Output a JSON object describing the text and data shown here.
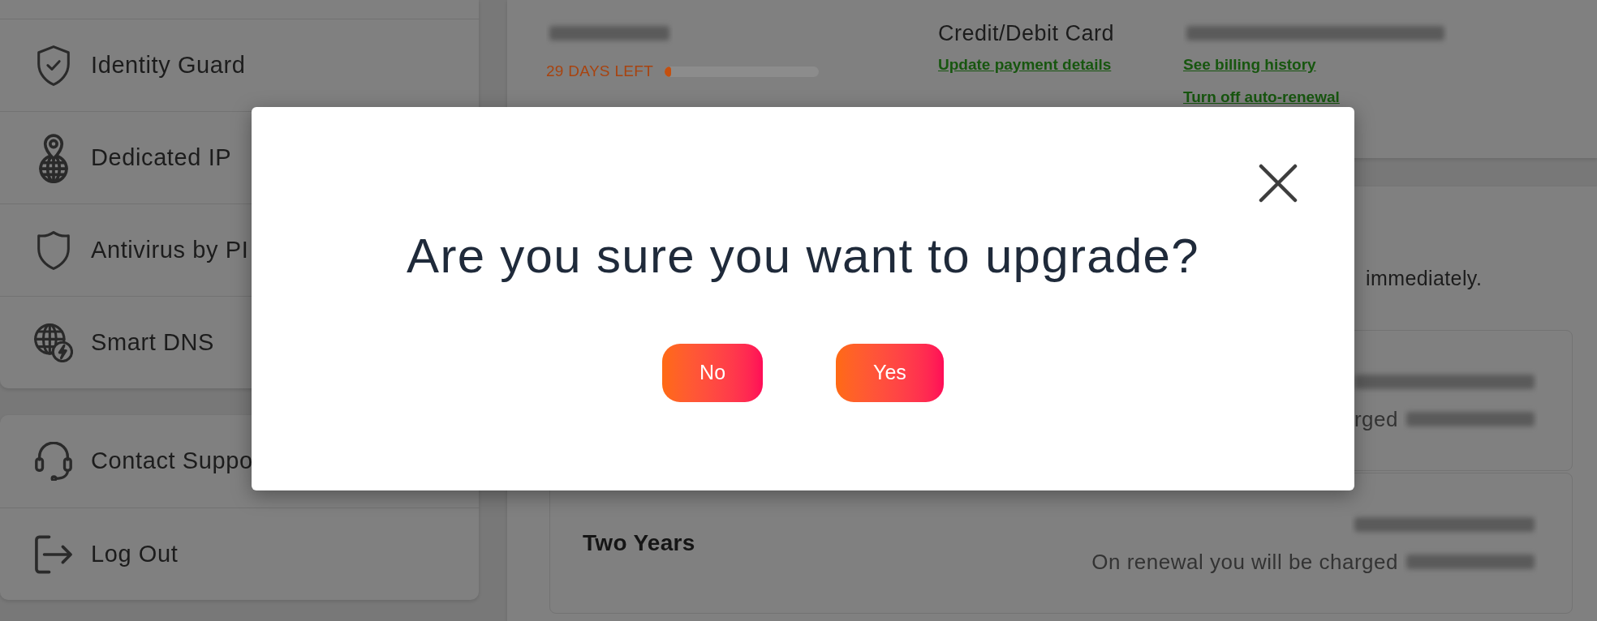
{
  "sidebar": {
    "groups": [
      {
        "items": [
          {
            "label": "Identity Guard",
            "selected": false
          },
          {
            "label": "Dedicated IP",
            "selected": false
          },
          {
            "label": "Antivirus by PI",
            "selected": false
          },
          {
            "label": "Smart DNS",
            "selected": false
          }
        ]
      },
      {
        "items": [
          {
            "label": "Contact Suppo",
            "selected": false
          },
          {
            "label": "Log Out",
            "selected": false
          }
        ]
      }
    ]
  },
  "subscription": {
    "days_left": "29 DAYS LEFT",
    "level": 0.04
  },
  "payment": {
    "method": "Credit/Debit Card",
    "link": "Update payment details"
  },
  "billing": {
    "links": [
      "See billing history",
      "Turn off auto-renewal"
    ]
  },
  "upgrade": {
    "description": "immediately.",
    "plans": [
      {
        "renewal_text": "rged"
      },
      {
        "name": "Two Years",
        "renewal_text": "On renewal you will be charged"
      }
    ]
  },
  "modal": {
    "title": "Are you sure you want to upgrade?",
    "buttons": [
      "No",
      "Yes"
    ]
  }
}
